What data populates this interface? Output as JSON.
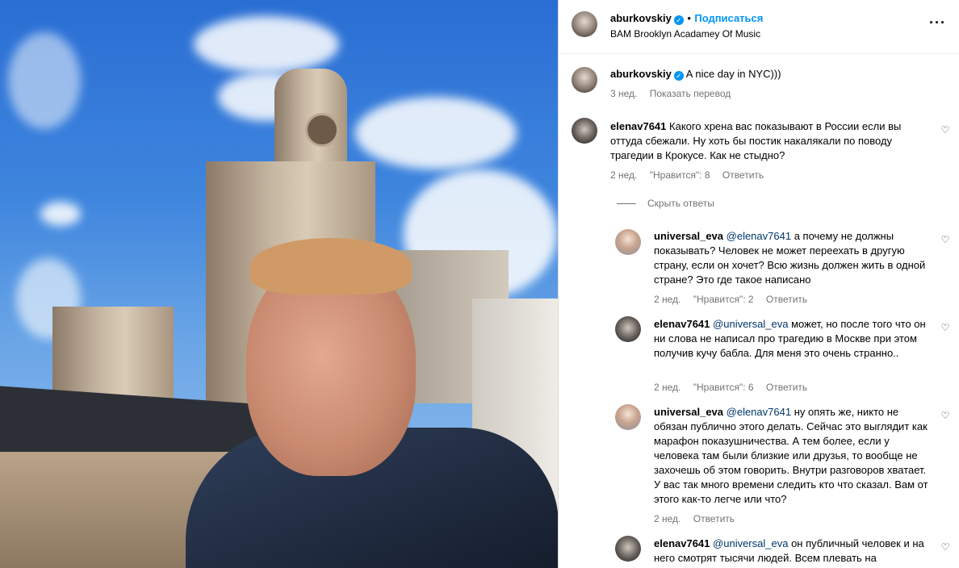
{
  "post": {
    "author": "aburkovskiy",
    "follow_label": "Подписаться",
    "separator": "•",
    "location": "BAM Brooklyn Acadamey Of Music",
    "more_icon": "more-horizontal-icon",
    "caption": "A nice day in NYC)))",
    "caption_time": "3 нед.",
    "translate_label": "Показать перевод"
  },
  "comments": [
    {
      "user": "elenav7641",
      "text": "Какого хрена вас показывают в России если вы оттуда сбежали. Ну хоть бы постик накалякали по поводу трагедии в Крокусе. Как не стыдно?",
      "time": "2 нед.",
      "likes": "\"Нравится\": 8",
      "reply": "Ответить"
    }
  ],
  "hide_replies": "Скрыть ответы",
  "replies": [
    {
      "user": "universal_eva",
      "mention": "@elenav7641",
      "text": "а почему не должны показывать? Человек не может переехать в другую страну, если он хочет? Всю жизнь должен жить в одной стране? Это где такое написано",
      "time": "2 нед.",
      "likes": "\"Нравится\": 2",
      "reply": "Ответить"
    },
    {
      "user": "elenav7641",
      "mention": "@universal_eva",
      "text": "может, но после того что он ни слова не написал про трагедию в Москве при этом получив кучу бабла. Для меня это очень странно..",
      "time": "2 нед.",
      "likes": "\"Нравится\": 6",
      "reply": "Ответить"
    },
    {
      "user": "universal_eva",
      "mention": "@elenav7641",
      "text": "ну опять же, никто не обязан публично этого делать. Сейчас это выглядит как марафон показушничества. А тем более, если у человека там были близкие или друзья, то вообще не захочешь об этом говорить. Внутри разговоров хватает. У вас так много времени следить кто что сказал. Вам от этого как-то легче или что?",
      "time": "2 нед.",
      "likes": "",
      "reply": "Ответить"
    },
    {
      "user": "elenav7641",
      "mention": "@universal_eva",
      "text": "он публичный человек и на него смотрят тысячи людей. Всем плевать на",
      "time": "",
      "likes": "",
      "reply": ""
    }
  ],
  "icons": {
    "verified": "verified-badge-icon",
    "heart": "heart-outline-icon"
  }
}
